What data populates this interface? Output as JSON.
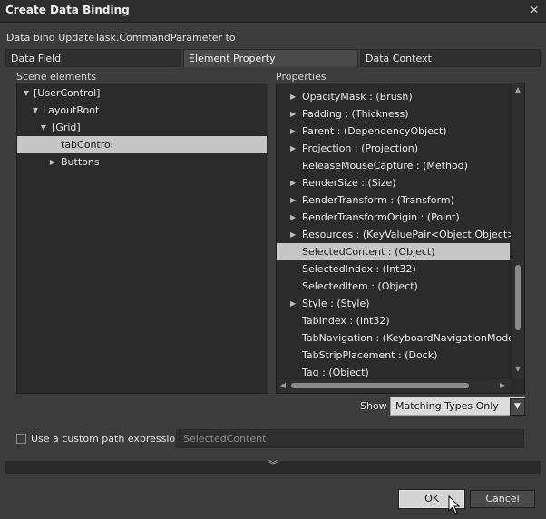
{
  "window": {
    "title": "Create Data Binding",
    "close_glyph": "✕"
  },
  "subtitle": "Data bind UpdateTask.CommandParameter to",
  "tabs": [
    {
      "label": "Data Field",
      "active": false
    },
    {
      "label": "Element Property",
      "active": true
    },
    {
      "label": "Data Context",
      "active": false
    }
  ],
  "scene": {
    "header": "Scene elements",
    "items": [
      {
        "label": "[UserControl]",
        "expander": "▼",
        "selected": false
      },
      {
        "label": "LayoutRoot",
        "expander": "▼",
        "selected": false
      },
      {
        "label": "[Grid]",
        "expander": "▼",
        "selected": false
      },
      {
        "label": "tabControl",
        "expander": "",
        "selected": true
      },
      {
        "label": "Buttons",
        "expander": "▶",
        "selected": false
      }
    ]
  },
  "properties": {
    "header": "Properties",
    "items": [
      {
        "label": "OpacityMask : (Brush)",
        "expander": "▶",
        "selected": false
      },
      {
        "label": "Padding : (Thickness)",
        "expander": "▶",
        "selected": false
      },
      {
        "label": "Parent : (DependencyObject)",
        "expander": "▶",
        "selected": false
      },
      {
        "label": "Projection : (Projection)",
        "expander": "▶",
        "selected": false
      },
      {
        "label": "ReleaseMouseCapture : (Method)",
        "expander": "",
        "selected": false
      },
      {
        "label": "RenderSize : (Size)",
        "expander": "▶",
        "selected": false
      },
      {
        "label": "RenderTransform : (Transform)",
        "expander": "▶",
        "selected": false
      },
      {
        "label": "RenderTransformOrigin : (Point)",
        "expander": "▶",
        "selected": false
      },
      {
        "label": "Resources : (KeyValuePair<Object,Object>)",
        "expander": "▶",
        "selected": false
      },
      {
        "label": "SelectedContent : (Object)",
        "expander": "",
        "selected": true
      },
      {
        "label": "SelectedIndex : (Int32)",
        "expander": "",
        "selected": false
      },
      {
        "label": "SelectedItem : (Object)",
        "expander": "",
        "selected": false
      },
      {
        "label": "Style : (Style)",
        "expander": "▶",
        "selected": false
      },
      {
        "label": "TabIndex : (Int32)",
        "expander": "",
        "selected": false
      },
      {
        "label": "TabNavigation : (KeyboardNavigationMode)",
        "expander": "",
        "selected": false
      },
      {
        "label": "TabStripPlacement : (Dock)",
        "expander": "",
        "selected": false
      },
      {
        "label": "Tag : (Object)",
        "expander": "",
        "selected": false
      }
    ],
    "scroll_arrows": {
      "up": "▲",
      "down": "▼",
      "left": "◀",
      "right": "▶"
    }
  },
  "show": {
    "label": "Show",
    "value": "Matching Types Only",
    "dropdown_glyph": "▼"
  },
  "custom_path": {
    "label": "Use a custom path expression",
    "checked": false,
    "value": "SelectedContent"
  },
  "expander_glyph": "︾",
  "buttons": {
    "ok": "OK",
    "cancel": "Cancel"
  }
}
